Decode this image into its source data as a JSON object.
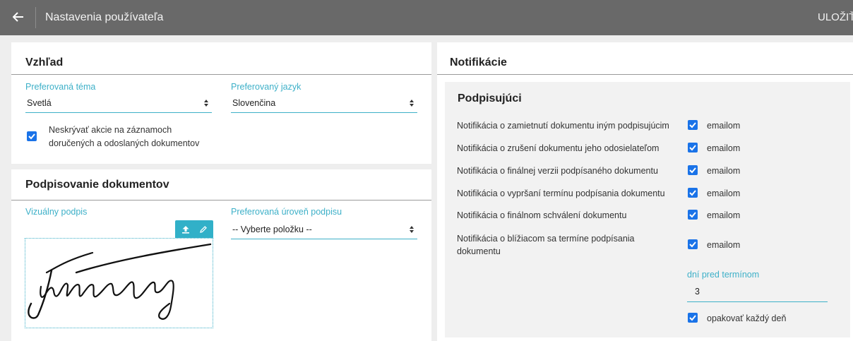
{
  "topbar": {
    "title": "Nastavenia používateľa",
    "save_label": "ULOŽIŤ",
    "back_icon": "arrow-left-icon"
  },
  "appearance": {
    "title": "Vzhľad",
    "theme": {
      "label": "Preferovaná téma",
      "value": "Svetlá"
    },
    "language": {
      "label": "Preferovaný jazyk",
      "value": "Slovenčina"
    },
    "show_actions": {
      "label_line1": "Neskrývať akcie na záznamoch",
      "label_line2": "doručených a odoslaných dokumentov",
      "checked": true
    }
  },
  "signing": {
    "title": "Podpisovanie dokumentov",
    "visual_signature_label": "Vizuálny podpis",
    "upload_icon": "upload-icon",
    "edit_icon": "pencil-icon",
    "level": {
      "label": "Preferovaná úroveň podpisu",
      "value": "-- Vyberte položku --"
    }
  },
  "notifications": {
    "title": "Notifikácie",
    "signers": {
      "title": "Podpisujúci",
      "items": [
        {
          "label": "Notifikácia o zamietnutí dokumentu iným podpisujúcim",
          "channel": "emailom",
          "checked": true
        },
        {
          "label": "Notifikácia o zrušení dokumentu jeho odosielateľom",
          "channel": "emailom",
          "checked": true
        },
        {
          "label": "Notifikácia o finálnej verzii podpísaného dokumentu",
          "channel": "emailom",
          "checked": true
        },
        {
          "label": "Notifikácia o vypršaní termínu podpísania dokumentu",
          "channel": "emailom",
          "checked": true
        },
        {
          "label": "Notifikácia o finálnom schválení dokumentu",
          "channel": "emailom",
          "checked": true
        },
        {
          "label_line1": "Notifikácia o blížiacom sa termíne podpísania",
          "label_line2": "dokumentu",
          "channel": "emailom",
          "checked": true
        }
      ],
      "days_before": {
        "label": "dní pred termínom",
        "value": "3"
      },
      "repeat_daily": {
        "label": "opakovať každý deň",
        "checked": true
      }
    }
  },
  "colors": {
    "topbar": "#696969",
    "accent": "#3db0c8",
    "checkbox": "#1a73e8",
    "toolbar": "#31b0c8"
  }
}
